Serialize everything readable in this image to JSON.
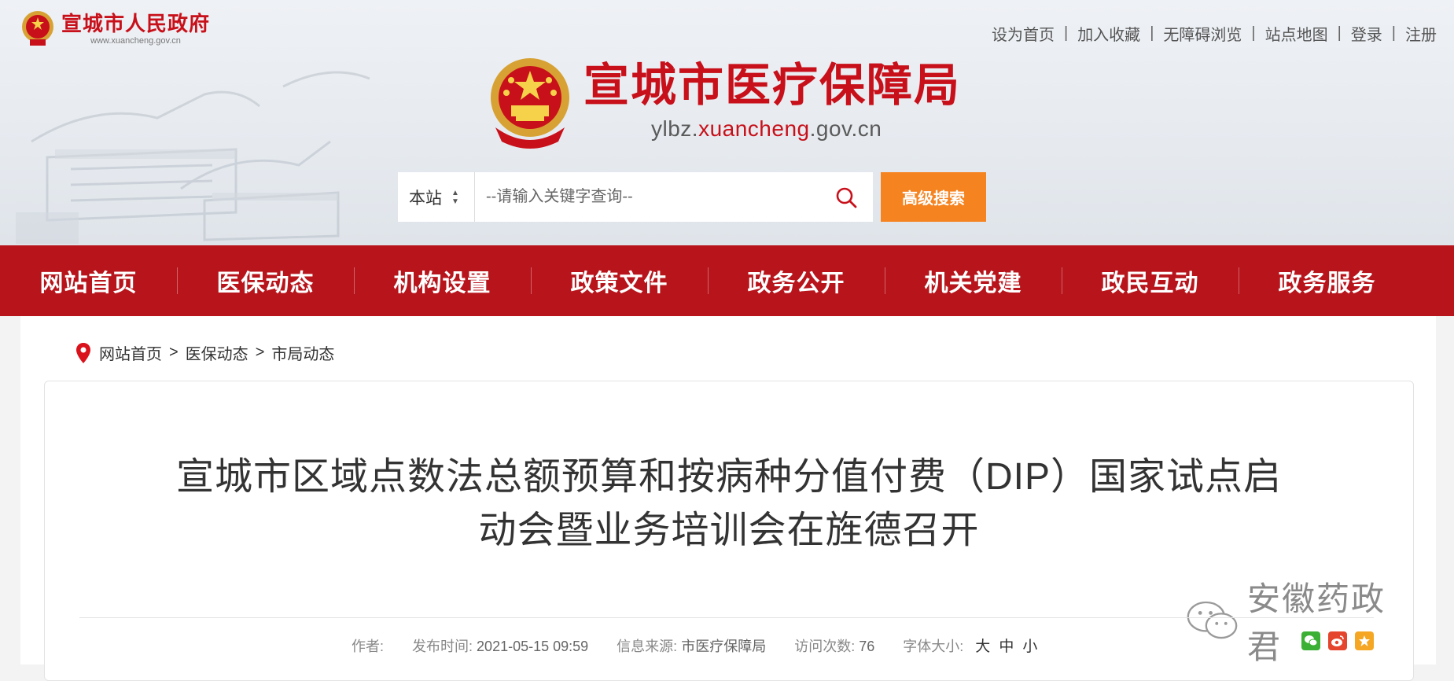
{
  "header": {
    "gov_name": "宣城市人民政府",
    "gov_url": "www.xuancheng.gov.cn",
    "top_links": [
      "设为首页",
      "加入收藏",
      "无障碍浏览",
      "站点地图",
      "登录",
      "注册"
    ],
    "site_title": "宣城市医疗保障局",
    "site_url_prefix": "ylbz.",
    "site_url_domain": "xuancheng",
    "site_url_suffix": ".gov.cn"
  },
  "search": {
    "scope": "本站",
    "placeholder": "--请输入关键字查询--",
    "advanced_label": "高级搜索"
  },
  "nav": {
    "items": [
      "网站首页",
      "医保动态",
      "机构设置",
      "政策文件",
      "政务公开",
      "机关党建",
      "政民互动",
      "政务服务"
    ]
  },
  "breadcrumb": [
    "网站首页",
    "医保动态",
    "市局动态"
  ],
  "article": {
    "title_line1": "宣城市区域点数法总额预算和按病种分值付费（DIP）国家试点启",
    "title_line2": "动会暨业务培训会在旌德召开",
    "meta": {
      "author_label": "作者:",
      "author": "",
      "date_label": "发布时间:",
      "date": "2021-05-15 09:59",
      "source_label": "信息来源:",
      "source": "市医疗保障局",
      "visits_label": "访问次数:",
      "visits": "76",
      "font_label": "字体大小:",
      "font_large": "大",
      "font_medium": "中",
      "font_small": "小"
    }
  },
  "watermark": "安徽药政君",
  "colors": {
    "brand_red": "#c8101a",
    "nav_red": "#b7141b",
    "search_orange": "#f58320"
  }
}
